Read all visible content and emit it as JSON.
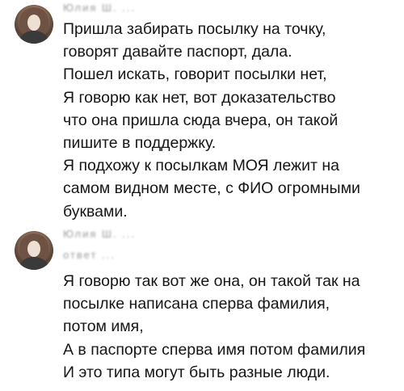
{
  "comments": [
    {
      "author": "Юлия Ш. ...",
      "text": "Пришла забирать посылку на точку,\nговорят давайте паспорт, дала.\nПошел искать, говорит посылки нет,\nЯ говорю как нет, вот доказательство\nчто она пришла сюда вчера, он такой\nпишите в поддержку.\nЯ подхожу к посылкам МОЯ лежит на\nсамом видном месте, с ФИО огромными\nбуквами."
    },
    {
      "author": "Юлия Ш. ...",
      "reply_to": "ответ ...",
      "text": "Я говорю так вот же она, он такой так на\nпосылке написана сперва фамилия,\nпотом имя,\nА в паспорте сперва имя потом фамилия\nИ это типа могут быть разные люди."
    }
  ]
}
